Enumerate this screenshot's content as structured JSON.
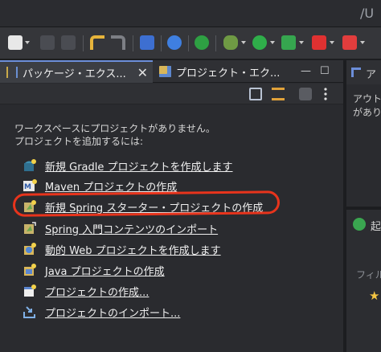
{
  "window": {
    "title": "/U"
  },
  "tabs": [
    {
      "label": "パッケージ・エクス...",
      "close": "✕"
    },
    {
      "label": "プロジェクト・エク..."
    }
  ],
  "window_buttons": {
    "minimize": "—",
    "maximize": "☐"
  },
  "message": {
    "line1": "ワークスペースにプロジェクトがありません。",
    "line2": "プロジェクトを追加するには:"
  },
  "links": [
    {
      "label": "新規 Gradle プロジェクトを作成します",
      "icon": "gradle-project-icon"
    },
    {
      "label": "Maven プロジェクトの作成",
      "icon": "maven-project-icon"
    },
    {
      "label": "新規 Spring スターター・プロジェクトの作成",
      "icon": "spring-starter-icon"
    },
    {
      "label": "Spring 入門コンテンツのインポート",
      "icon": "spring-import-icon"
    },
    {
      "label": "動的 Web プロジェクトを作成します",
      "icon": "web-project-icon"
    },
    {
      "label": "Java プロジェクトの作成",
      "icon": "java-project-icon"
    },
    {
      "label": "プロジェクトの作成...",
      "icon": "new-project-icon"
    },
    {
      "label": "プロジェクトのインポート...",
      "icon": "import-project-icon"
    }
  ],
  "right_panel": {
    "tab_label": "ア",
    "outline_line1": "アウト",
    "outline_line2": "があり",
    "lower_tab": "起",
    "filter_label": "フィル"
  },
  "colors": {
    "highlight": "#e8341c",
    "background": "#2a2b2f",
    "tab_accent": "#6c8ed9"
  }
}
